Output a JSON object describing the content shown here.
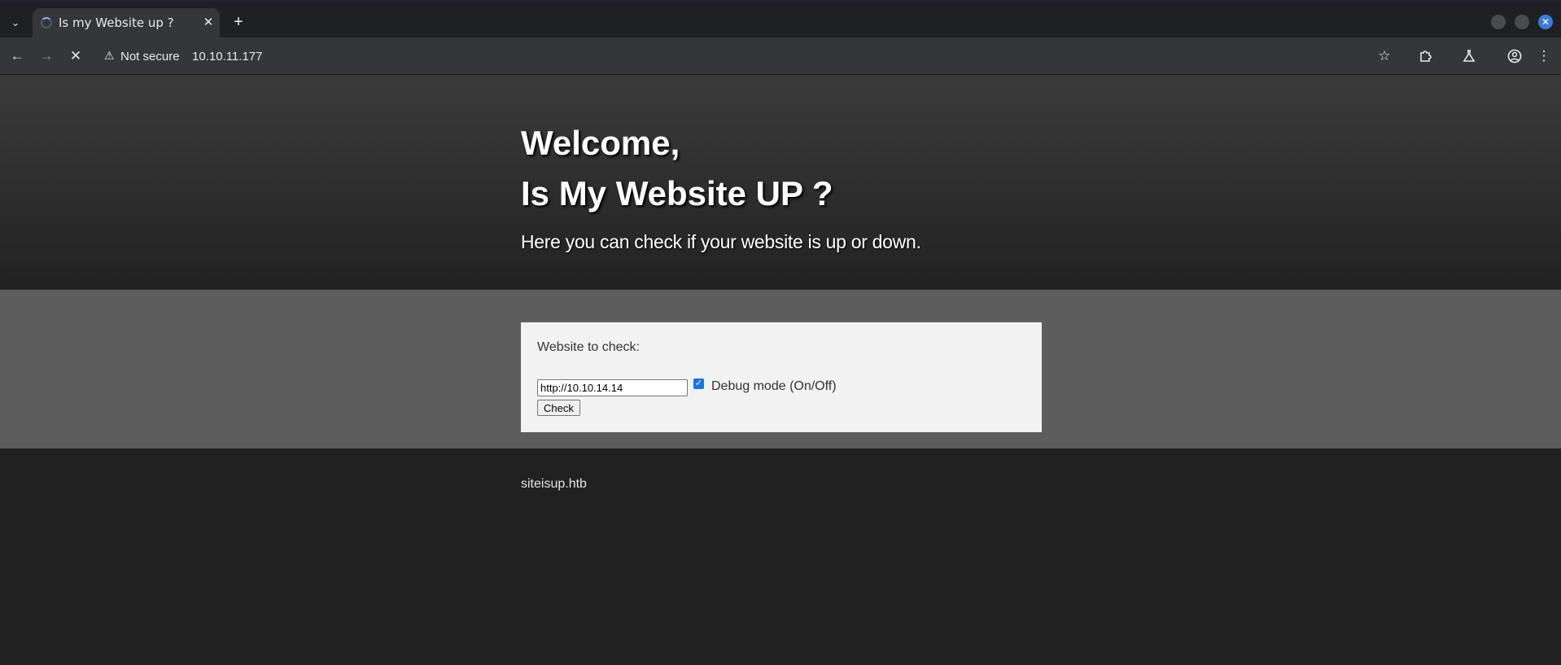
{
  "browser": {
    "tab_title": "Is my Website up ?",
    "tab_close": "✕",
    "new_tab": "+",
    "security_label": "Not secure",
    "url": "10.10.11.177"
  },
  "page": {
    "heading_line1": "Welcome,",
    "heading_line2": "Is My Website UP ?",
    "subtitle": "Here you can check if your website is up or down.",
    "form": {
      "label": "Website to check:",
      "url_value": "http://10.10.14.14",
      "debug_checked": true,
      "debug_label": "Debug mode (On/Off)",
      "submit_label": "Check"
    },
    "footer": "siteisup.htb"
  },
  "colors": {
    "accent": "#1a73e8",
    "hero_top": "#3b3b3b",
    "band": "#5e5d5e",
    "footer_bg": "#212121"
  }
}
